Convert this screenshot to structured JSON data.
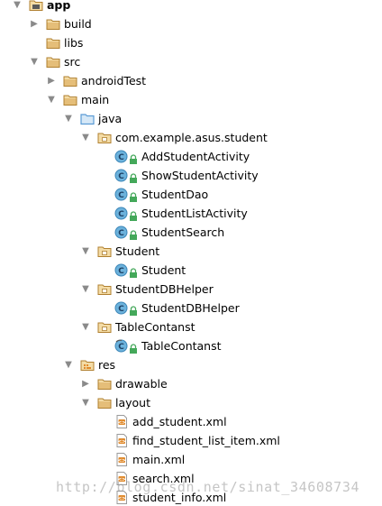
{
  "project_tree": {
    "items": [
      {
        "label": "app",
        "depth": 0,
        "icon": "module",
        "expanded": true,
        "bold": true
      },
      {
        "label": "build",
        "depth": 1,
        "icon": "folder",
        "expanded": false
      },
      {
        "label": "libs",
        "depth": 1,
        "icon": "folder",
        "expanded": null
      },
      {
        "label": "src",
        "depth": 1,
        "icon": "folder",
        "expanded": true
      },
      {
        "label": "androidTest",
        "depth": 2,
        "icon": "folder",
        "expanded": false
      },
      {
        "label": "main",
        "depth": 2,
        "icon": "folder",
        "expanded": true
      },
      {
        "label": "java",
        "depth": 3,
        "icon": "source-folder",
        "expanded": true
      },
      {
        "label": "com.example.asus.student",
        "depth": 4,
        "icon": "package",
        "expanded": true
      },
      {
        "label": "AddStudentActivity",
        "depth": 5,
        "icon": "class",
        "expanded": null
      },
      {
        "label": "ShowStudentActivity",
        "depth": 5,
        "icon": "class",
        "expanded": null
      },
      {
        "label": "StudentDao",
        "depth": 5,
        "icon": "class",
        "expanded": null
      },
      {
        "label": "StudentListActivity",
        "depth": 5,
        "icon": "class",
        "expanded": null
      },
      {
        "label": "StudentSearch",
        "depth": 5,
        "icon": "class",
        "expanded": null
      },
      {
        "label": "Student",
        "depth": 4,
        "icon": "package",
        "expanded": true
      },
      {
        "label": "Student",
        "depth": 5,
        "icon": "class",
        "expanded": null
      },
      {
        "label": "StudentDBHelper",
        "depth": 4,
        "icon": "package",
        "expanded": true
      },
      {
        "label": "StudentDBHelper",
        "depth": 5,
        "icon": "class",
        "expanded": null
      },
      {
        "label": "TableContanst",
        "depth": 4,
        "icon": "package",
        "expanded": true
      },
      {
        "label": "TableContanst",
        "depth": 5,
        "icon": "class-abstract",
        "expanded": null
      },
      {
        "label": "res",
        "depth": 3,
        "icon": "resource-folder",
        "expanded": true
      },
      {
        "label": "drawable",
        "depth": 4,
        "icon": "folder",
        "expanded": false
      },
      {
        "label": "layout",
        "depth": 4,
        "icon": "folder",
        "expanded": true
      },
      {
        "label": "add_student.xml",
        "depth": 5,
        "icon": "xml-file",
        "expanded": null
      },
      {
        "label": "find_student_list_item.xml",
        "depth": 5,
        "icon": "xml-file",
        "expanded": null
      },
      {
        "label": "main.xml",
        "depth": 5,
        "icon": "xml-file",
        "expanded": null
      },
      {
        "label": "search.xml",
        "depth": 5,
        "icon": "xml-file",
        "expanded": null
      },
      {
        "label": "student_info.xml",
        "depth": 5,
        "icon": "xml-file",
        "expanded": null
      }
    ]
  },
  "watermark": {
    "text": "http://blog.csdn.net/sinat_34608734"
  },
  "colors": {
    "folder": "#d9a653",
    "folder_dark": "#b08030",
    "source_folder": "#5b9bd5",
    "class_circle": "#6cb2dc",
    "lock_green": "#44a85a",
    "xml_orange": "#e08a2c",
    "arrow": "#8a8a8a"
  }
}
